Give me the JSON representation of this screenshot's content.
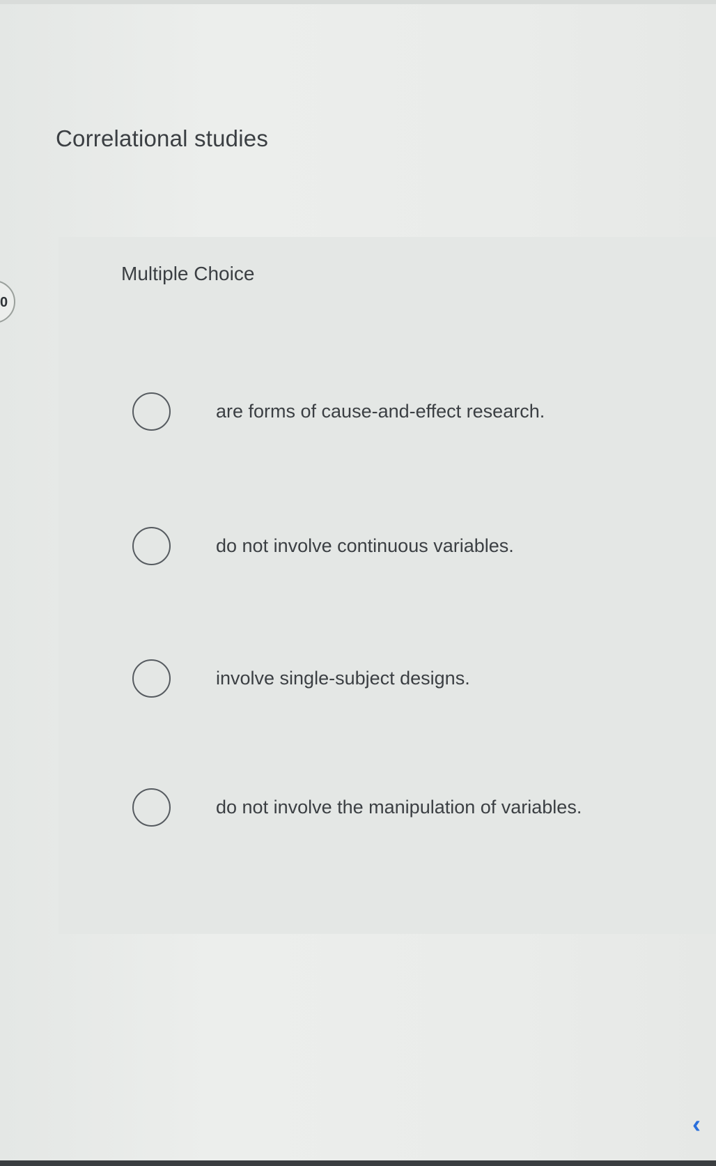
{
  "question": {
    "text": "Correlational studies"
  },
  "side_badge": {
    "label": "0"
  },
  "multiple_choice": {
    "label": "Multiple Choice",
    "options": [
      {
        "text": "are forms of cause-and-effect research."
      },
      {
        "text": "do not involve continuous variables."
      },
      {
        "text": "involve single-subject designs."
      },
      {
        "text": "do not involve the manipulation of variables."
      }
    ]
  },
  "navigation": {
    "prev_icon": "chevron-left-icon",
    "accent_color": "#2a6fdb"
  }
}
